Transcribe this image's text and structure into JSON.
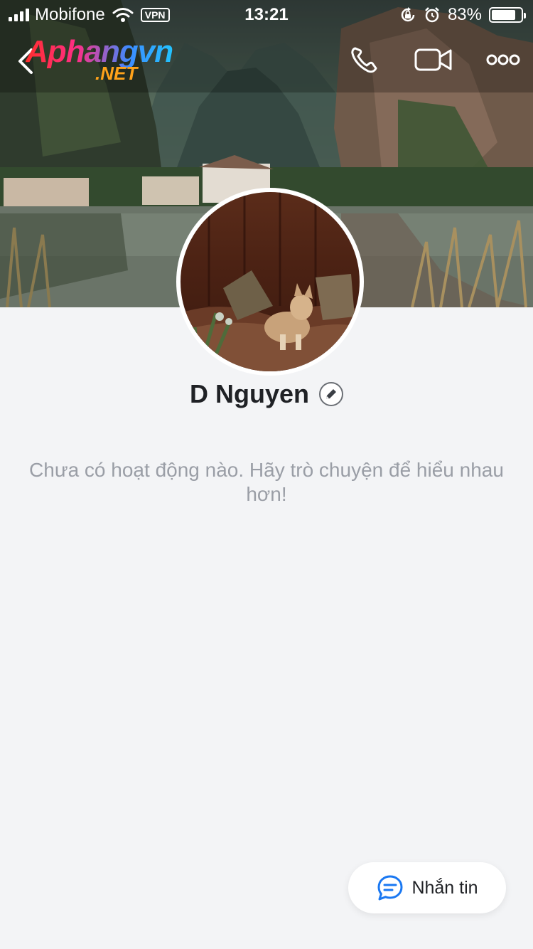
{
  "status_bar": {
    "carrier": "Mobifone",
    "vpn": "VPN",
    "time": "13:21",
    "battery": "83%",
    "battery_level": 0.83
  },
  "header": {
    "logo_main": "Aphangvn",
    "logo_sub": ".NET",
    "icons": [
      "back-icon",
      "phone-icon",
      "video-call-icon",
      "more-icon"
    ]
  },
  "profile": {
    "name": "D Nguyen",
    "empty_message": "Chưa có hoạt động nào. Hãy trò chuyện để hiểu nhau hơn!"
  },
  "actions": {
    "message_label": "Nhắn tin"
  },
  "colors": {
    "background": "#f3f4f6",
    "name_text": "#1f2125",
    "empty_text": "#9a9ea6",
    "accent": "#1a78f2"
  }
}
